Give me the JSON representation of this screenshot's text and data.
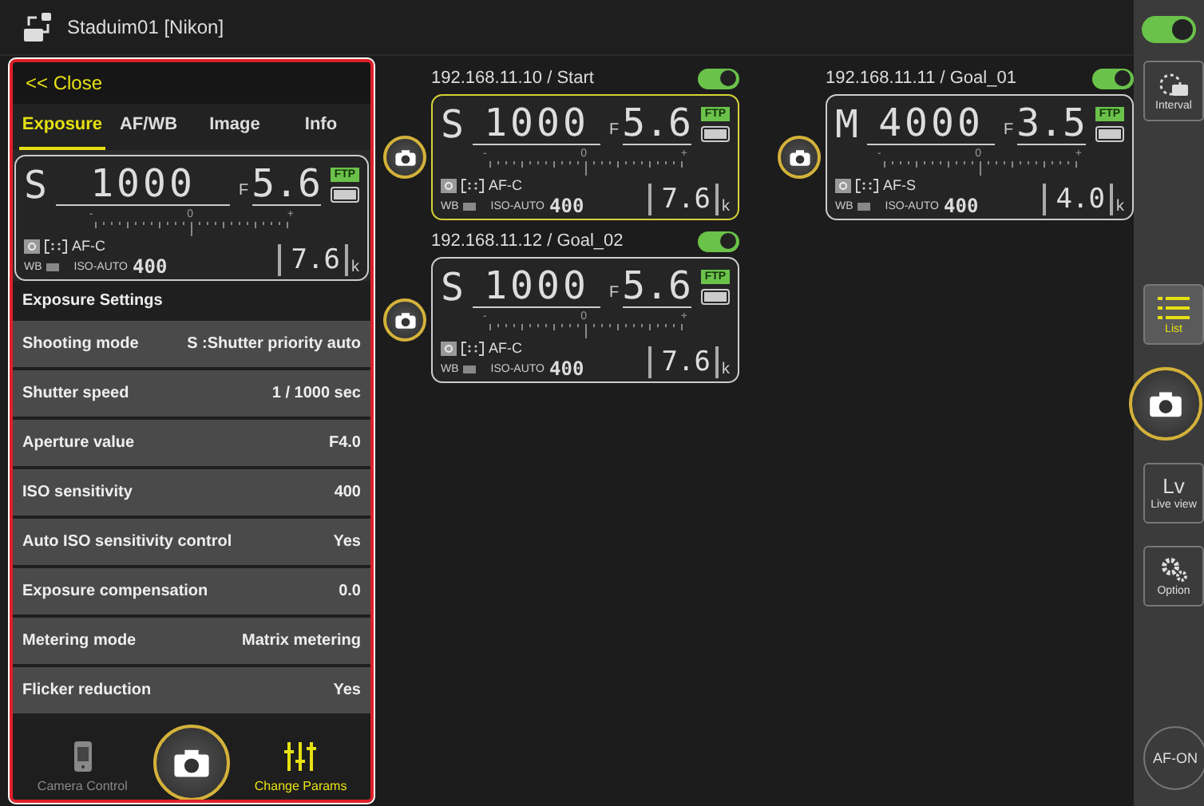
{
  "window": {
    "title": "Staduim01 [Nikon]"
  },
  "panel": {
    "close": "<< Close",
    "tabs": [
      {
        "label": "Exposure",
        "selected": true
      },
      {
        "label": "AF/WB",
        "selected": false
      },
      {
        "label": "Image",
        "selected": false
      },
      {
        "label": "Info",
        "selected": false
      }
    ],
    "display": {
      "mode": "S",
      "shutter": "1000",
      "f": "F",
      "aperture": "5.6",
      "badge": "FTP",
      "scale": [
        "-",
        "0",
        "+"
      ],
      "af": "AF-C",
      "wb": "WB",
      "iso_label": "ISO-AUTO",
      "iso": "400",
      "count": "7.6",
      "unit": "k"
    },
    "section": "Exposure Settings",
    "settings": [
      {
        "label": "Shooting mode",
        "value": "S :Shutter priority auto"
      },
      {
        "label": "Shutter speed",
        "value": "1 / 1000 sec"
      },
      {
        "label": "Aperture value",
        "value": "F4.0"
      },
      {
        "label": "ISO sensitivity",
        "value": "400"
      },
      {
        "label": "Auto ISO sensitivity control",
        "value": "Yes"
      },
      {
        "label": "Exposure compensation",
        "value": "0.0"
      },
      {
        "label": "Metering mode",
        "value": "Matrix metering"
      },
      {
        "label": "Flicker reduction",
        "value": "Yes"
      }
    ],
    "bottom": [
      {
        "kind": "camera-control",
        "label": "Camera Control",
        "selected": false
      },
      {
        "kind": "shutter"
      },
      {
        "kind": "params",
        "label": "Change Params",
        "selected": true
      }
    ]
  },
  "cameras": [
    {
      "title": "192.168.11.10 / Start",
      "on": true,
      "selected": true,
      "display": {
        "mode": "S",
        "shutter": "1000",
        "f": "F",
        "aperture": "5.6",
        "badge": "FTP",
        "scale": [
          "-",
          "0",
          "+"
        ],
        "af": "AF-C",
        "wb": "WB",
        "iso_label": "ISO-AUTO",
        "iso": "400",
        "count": "7.6",
        "unit": "k"
      }
    },
    {
      "title": "192.168.11.12 / Goal_02",
      "on": true,
      "selected": false,
      "display": {
        "mode": "S",
        "shutter": "1000",
        "f": "F",
        "aperture": "5.6",
        "badge": "FTP",
        "scale": [
          "-",
          "0",
          "+"
        ],
        "af": "AF-C",
        "wb": "WB",
        "iso_label": "ISO-AUTO",
        "iso": "400",
        "count": "7.6",
        "unit": "k"
      }
    },
    {
      "title": "192.168.11.11 / Goal_01",
      "on": true,
      "selected": false,
      "display": {
        "mode": "M",
        "shutter": "4000",
        "f": "F",
        "aperture": "3.5",
        "badge": "FTP",
        "scale": [
          "-",
          "0",
          "+"
        ],
        "af": "AF-S",
        "wb": "WB",
        "iso_label": "ISO-AUTO",
        "iso": "400",
        "count": "4.0",
        "unit": "k"
      }
    }
  ],
  "sidebar": {
    "on": true,
    "tools": [
      {
        "kind": "interval",
        "label": "Interval",
        "selected": false
      },
      {
        "kind": "list",
        "label": "List",
        "selected": true
      },
      {
        "kind": "shutter"
      },
      {
        "kind": "lv",
        "text": "Lv",
        "label": "Live view",
        "selected": false
      },
      {
        "kind": "option",
        "label": "Option",
        "selected": false
      },
      {
        "kind": "afon",
        "text": "AF-ON"
      }
    ]
  }
}
